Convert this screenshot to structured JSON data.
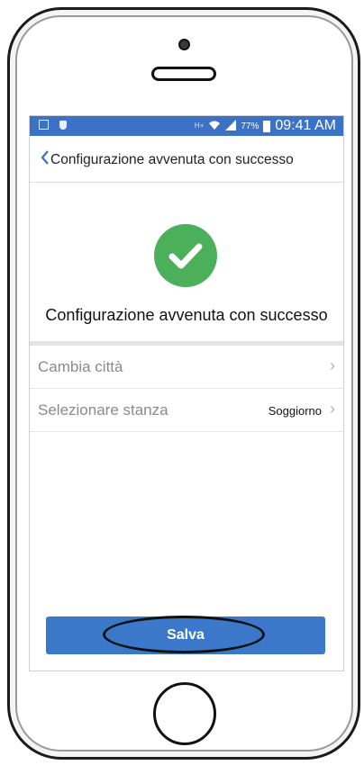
{
  "status_bar": {
    "hd_label": "H+",
    "battery_percent": "77%",
    "time": "09:41 AM"
  },
  "navbar": {
    "back_glyph": "‹",
    "title": "Configurazione avvenuta con successo"
  },
  "content": {
    "success_icon": "check-circle-icon",
    "success_message": "Configurazione avvenuta con successo",
    "rows": [
      {
        "label": "Cambia città",
        "value": ""
      },
      {
        "label": "Selezionare stanza",
        "value": "Soggiorno"
      }
    ],
    "chevron_glyph": "›"
  },
  "footer": {
    "save_label": "Salva"
  },
  "colors": {
    "accent": "#3b72c6",
    "success": "#4caf5a"
  }
}
